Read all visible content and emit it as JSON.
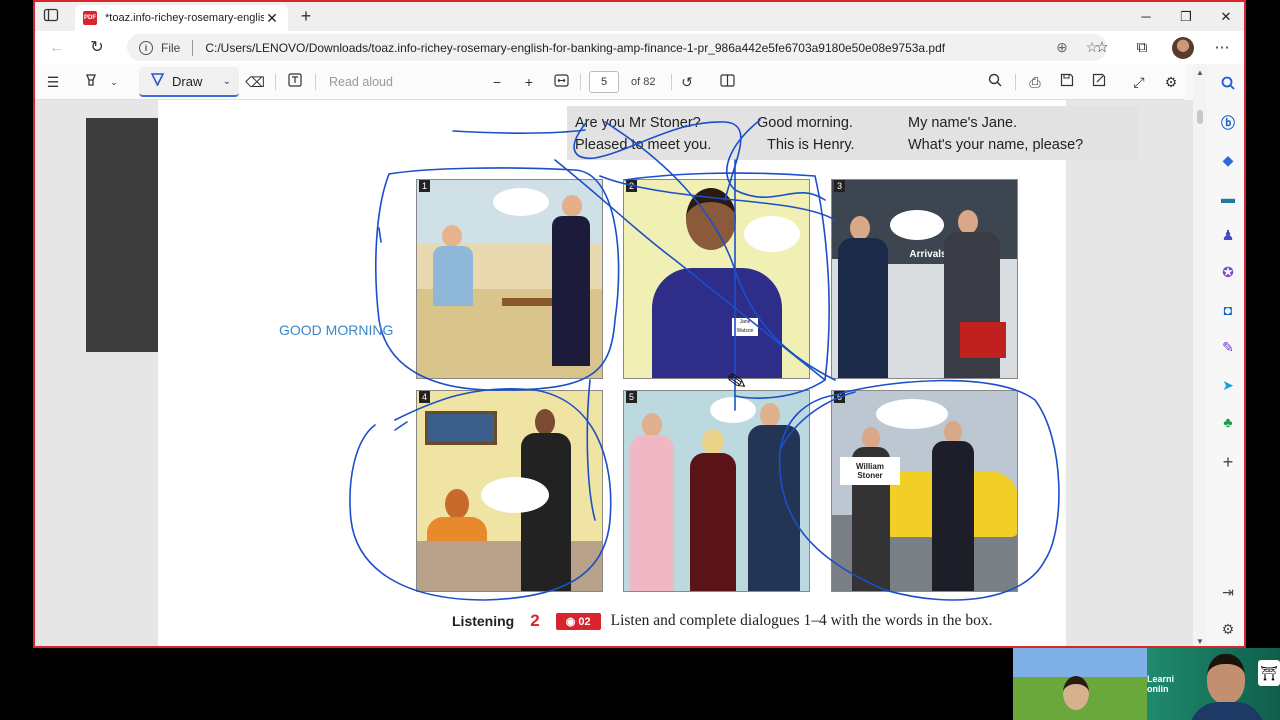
{
  "browser": {
    "tab_title": "*toaz.info-richey-rosemary-englis",
    "address_prefix": "File",
    "url": "C:/Users/LENOVO/Downloads/toaz.info-richey-rosemary-english-for-banking-amp-finance-1-pr_986a442e5fe6703a9180e50e08e9753a.pdf"
  },
  "pdf_toolbar": {
    "draw_label": "Draw",
    "read_aloud_label": "Read aloud",
    "current_page": "5",
    "page_count": "of 82"
  },
  "document": {
    "phrases": [
      "Are you Mr Stoner?",
      "Good morning.",
      "My name's Jane.",
      "Pleased to meet you.",
      "This is Henry.",
      "What's your name, please?"
    ],
    "panels": [
      {
        "number": "1"
      },
      {
        "number": "2",
        "badge": "Jane Watson"
      },
      {
        "number": "3",
        "sign": "Arrivals"
      },
      {
        "number": "4"
      },
      {
        "number": "5"
      },
      {
        "number": "6",
        "sign": "William Stoner"
      }
    ],
    "ink_text": "GOOD MORNING",
    "listening": {
      "label": "Listening",
      "number": "2",
      "track": "02",
      "instruction": "Listen and complete dialogues 1–4 with the words in the box."
    }
  },
  "webcam": {
    "brand_line1": "Learni",
    "brand_line2": "onlin"
  },
  "colors": {
    "accent": "#d9232d",
    "ink": "#1b4fc9",
    "draw_underline": "#3a6ed8"
  }
}
